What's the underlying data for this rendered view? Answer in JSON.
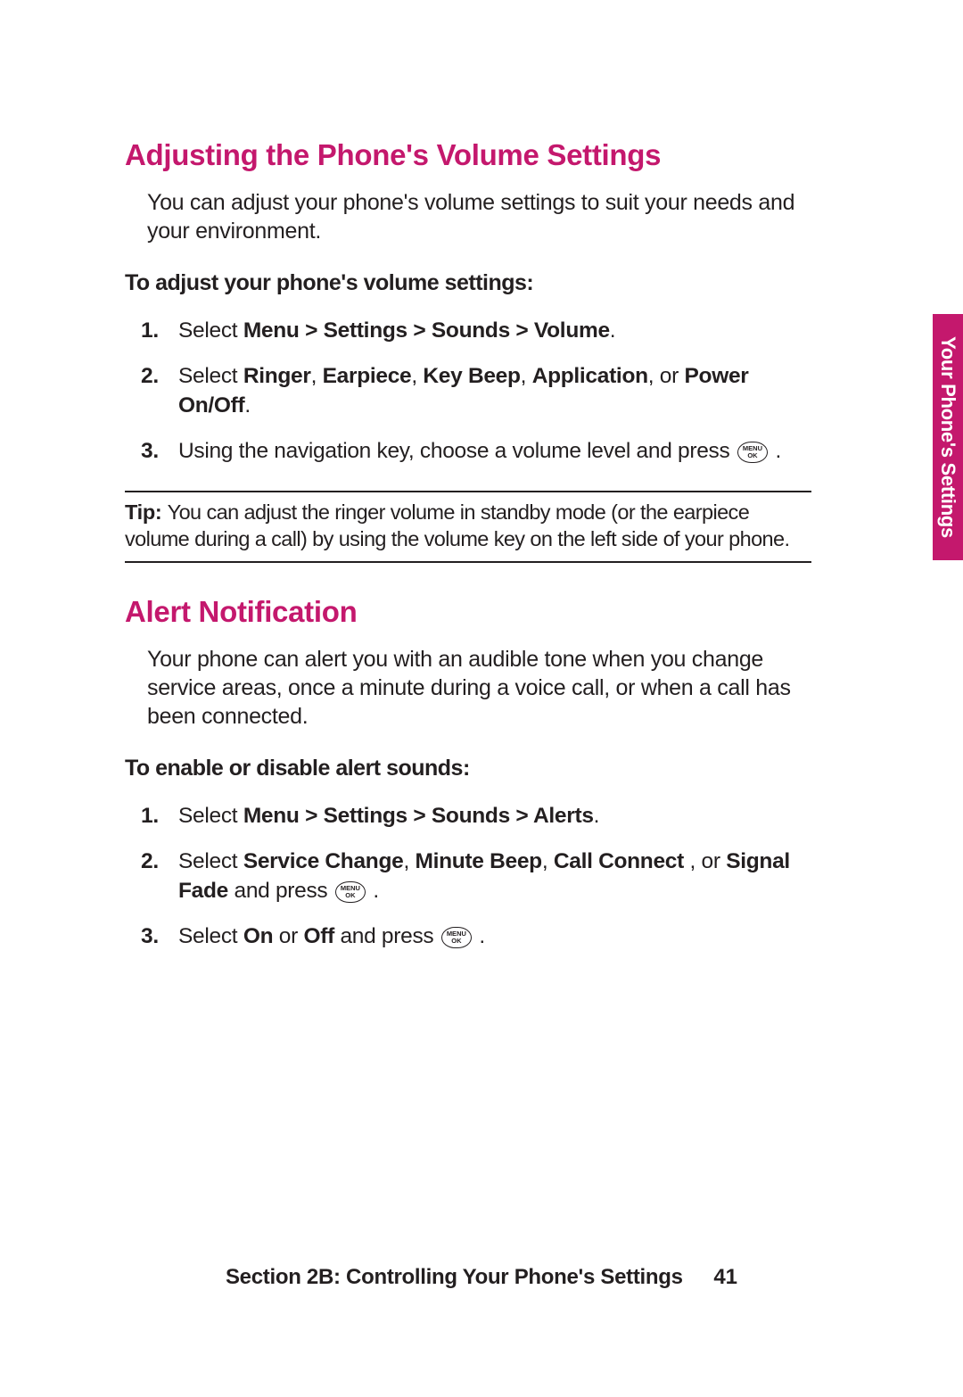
{
  "sideTab": "Your Phone's Settings",
  "section1": {
    "title": "Adjusting the Phone's Volume Settings",
    "intro": "You can adjust your phone's volume settings to suit your needs and your environment.",
    "subhead": "To adjust your phone's volume settings:",
    "steps": {
      "s1": {
        "num": "1.",
        "pre": "Select ",
        "bold": "Menu > Settings > Sounds > Volume",
        "post": "."
      },
      "s2": {
        "num": "2.",
        "pre": "Select ",
        "b1": "Ringer",
        "c1": ", ",
        "b2": "Earpiece",
        "c2": ", ",
        "b3": "Key Beep",
        "c3": ", ",
        "b4": "Application",
        "c4": ", or ",
        "b5": "Power On/Off",
        "post": "."
      },
      "s3": {
        "num": "3.",
        "pre": "Using the navigation key, choose a volume level and press ",
        "key": "MENU\nOK",
        "post": " ."
      }
    },
    "tip": {
      "label": "Tip: ",
      "text": "You can adjust the ringer volume in standby mode (or the earpiece volume during a call) by using the volume key on the left side of your phone."
    }
  },
  "section2": {
    "title": "Alert Notification",
    "intro": "Your phone can alert you with an audible tone when you change service areas, once a minute during a voice call, or when a call has been connected.",
    "subhead": "To enable or disable alert sounds:",
    "steps": {
      "s1": {
        "num": "1.",
        "pre": "Select ",
        "bold": "Menu > Settings > Sounds > Alerts",
        "post": "."
      },
      "s2": {
        "num": "2.",
        "pre": "Select ",
        "b1": "Service Change",
        "c1": ", ",
        "b2": "Minute Beep",
        "c2": ", ",
        "b3": "Call Connect",
        "c3": " , or ",
        "b4": "Signal Fade",
        "mid": " and press ",
        "key": "MENU\nOK",
        "post": " ."
      },
      "s3": {
        "num": "3.",
        "pre": "Select ",
        "b1": "On",
        "c1": " or ",
        "b2": "Off",
        "mid": " and press ",
        "key": "MENU\nOK",
        "post": " ."
      }
    }
  },
  "footer": {
    "title": "Section 2B: Controlling Your Phone's Settings",
    "page": "41"
  }
}
